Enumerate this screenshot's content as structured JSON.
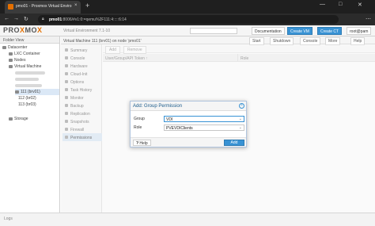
{
  "browser": {
    "tab_title": "pmo01 - Proxmox Virtual Enviro",
    "tab_close": "×",
    "new_tab": "+",
    "url_host": "pmo01",
    "url_rest": ":8006/#v1:0:=qemu%2F111:4:::::6:14",
    "win_min": "—",
    "win_max": "□",
    "win_close": "✕"
  },
  "header": {
    "logo_a": "PRO",
    "logo_x": "X",
    "logo_b": "MO",
    "logo_x2": "X",
    "version": "Virtual Environment 7.1-10",
    "buttons": [
      "Documentation",
      "Create VM",
      "Create CT",
      "root@pam"
    ]
  },
  "tree": {
    "view_label": "Folder View",
    "items": [
      "Datacenter",
      "LXC Container",
      "Nodes",
      "Virtual Machine",
      "111 (brv01)",
      "112 (br02)",
      "113 (br03)",
      "Storage"
    ]
  },
  "content": {
    "title": "Virtual Machine 111 (brv01) on node 'pmo01'",
    "actions": [
      "Start",
      "Shutdown",
      "Console",
      "More",
      "Help"
    ]
  },
  "subnav": {
    "items": [
      "Summary",
      "Console",
      "Hardware",
      "Cloud-Init",
      "Options",
      "Task History",
      "Monitor",
      "Backup",
      "Replication",
      "Snapshots",
      "Firewall",
      "Permissions"
    ],
    "selected": "Permissions"
  },
  "permissions": {
    "toolbar": [
      "Add",
      "Remove"
    ],
    "columns": [
      "User/Group/API Token ↑",
      "Role"
    ]
  },
  "dialog": {
    "title": "Add: Group Permission",
    "group_label": "Group",
    "group_value": "VDI",
    "role_label": "Role",
    "role_value": "PVEVDIClients",
    "help_label": "Help",
    "add_label": "Add"
  },
  "log": {
    "label": "Logs"
  }
}
